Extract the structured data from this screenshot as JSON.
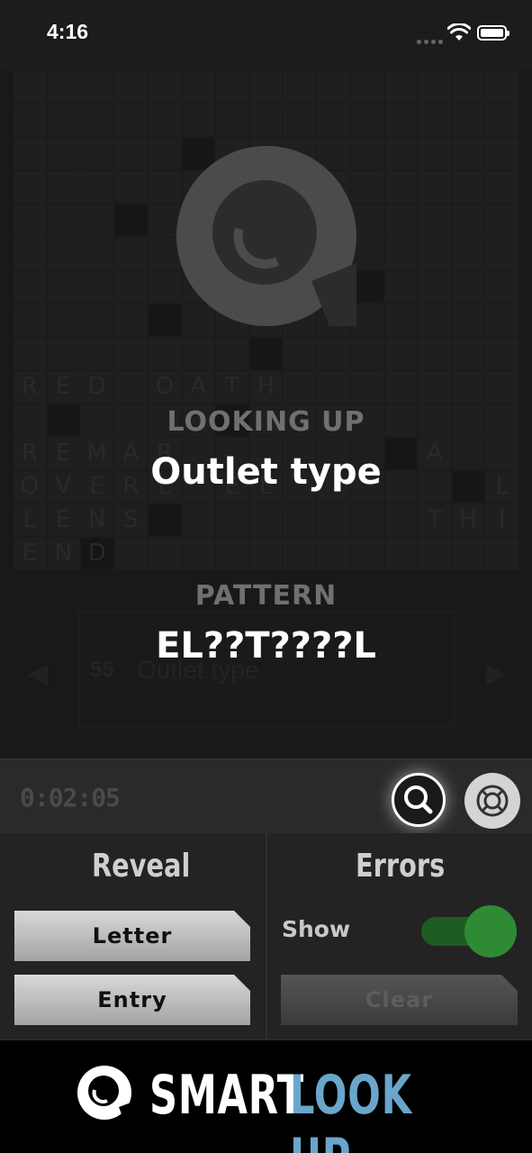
{
  "status_bar": {
    "time": "4:16"
  },
  "grid": {
    "rows": [
      "...............",
      "...............",
      "...............",
      "...............",
      "...............",
      "...............",
      "...............",
      "...............",
      "...............",
      "RED.OATH.......",
      "...............",
      "REMAR.......A..",
      "OVERL.EL......L",
      "LENS........THIS",
      "END............"
    ]
  },
  "clue_bar": {
    "number": "55",
    "text": "Outlet type",
    "prev_icon": "chevron-left-icon",
    "next_icon": "chevron-right-icon"
  },
  "overlay": {
    "looking_up_label": "LOOKING UP",
    "clue": "Outlet type",
    "pattern_label": "PATTERN",
    "pattern": "EL??T????L"
  },
  "toolbar": {
    "timer": "0:02:05",
    "lookup_icon": "magnifier-icon",
    "help_icon": "lifebuoy-icon"
  },
  "reveal": {
    "heading": "Reveal",
    "letter_label": "Letter",
    "entry_label": "Entry"
  },
  "errors": {
    "heading": "Errors",
    "show_label": "Show",
    "show_enabled": true,
    "clear_label": "Clear"
  },
  "banner": {
    "word1": "SMART",
    "word2": "LOOK UP",
    "accent_color": "#6aa6cc"
  }
}
